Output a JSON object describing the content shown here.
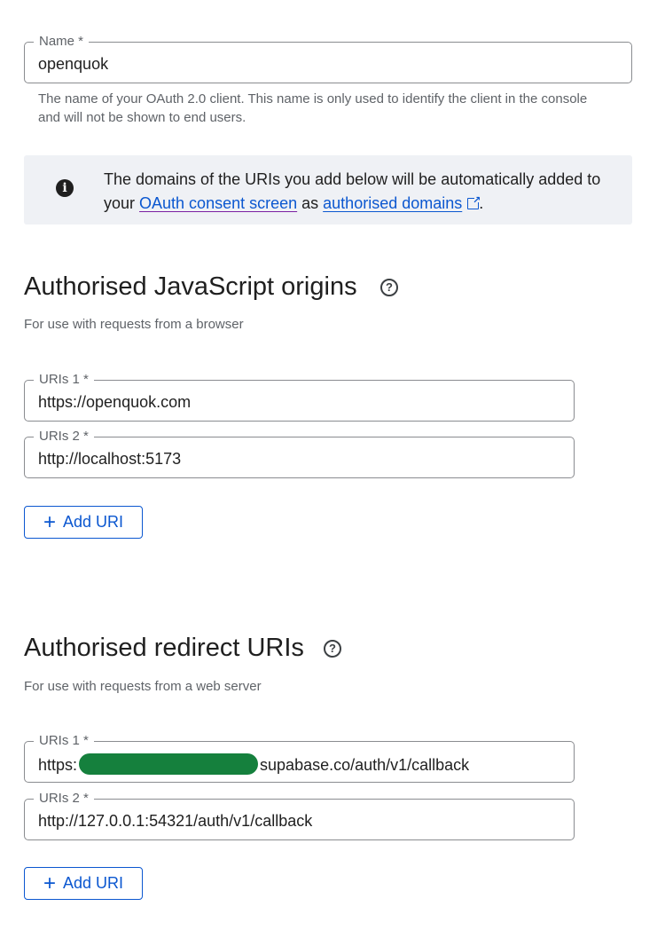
{
  "name_field": {
    "label": "Name *",
    "value": "openquok",
    "help": "The name of your OAuth 2.0 client. This name is only used to identify the client in the console and will not be shown to end users."
  },
  "info": {
    "text_before": "The domains of the URIs you add below will be automatically added to your ",
    "link1": "OAuth consent screen",
    "text_middle": " as ",
    "link2": "authorised domains",
    "text_after": "."
  },
  "js_origins": {
    "title": "Authorised JavaScript origins",
    "subtitle": "For use with requests from a browser",
    "uris": [
      {
        "label": "URIs 1 *",
        "value": "https://openquok.com"
      },
      {
        "label": "URIs 2 *",
        "value": "http://localhost:5173"
      }
    ],
    "add_button": "Add URI"
  },
  "redirect_uris": {
    "title": "Authorised redirect URIs",
    "subtitle": "For use with requests from a web server",
    "uris": [
      {
        "label": "URIs 1 *",
        "value_prefix": "https:",
        "value_suffix": "supabase.co/auth/v1/callback"
      },
      {
        "label": "URIs 2 *",
        "value": "http://127.0.0.1:54321/auth/v1/callback"
      }
    ],
    "add_button": "Add URI"
  },
  "colors": {
    "accent": "#0b57d0",
    "info_bg": "#eff1f5",
    "redaction": "#15803d"
  }
}
